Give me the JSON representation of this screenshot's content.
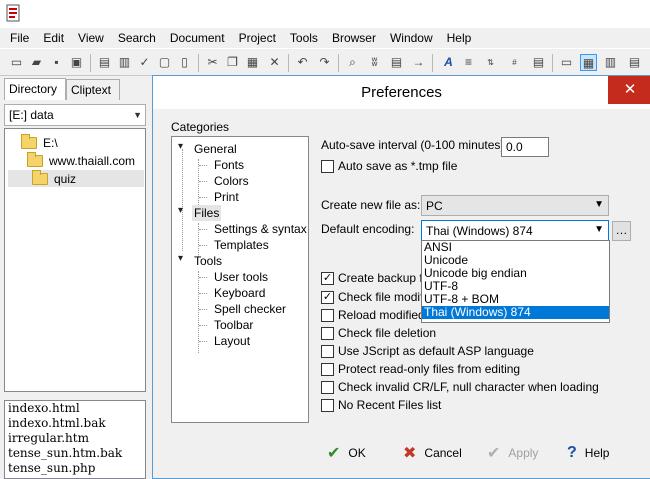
{
  "menu": [
    "File",
    "Edit",
    "View",
    "Search",
    "Document",
    "Project",
    "Tools",
    "Browser",
    "Window",
    "Help"
  ],
  "left": {
    "tabs": [
      "Directory",
      "Cliptext"
    ],
    "drive": "[E:] data",
    "tree": [
      {
        "label": "E:\\",
        "level": 0
      },
      {
        "label": "www.thaiall.com",
        "level": 1
      },
      {
        "label": "quiz",
        "level": 2,
        "selected": true
      }
    ],
    "files": [
      "indexo.html",
      "indexo.html.bak",
      "irregular.htm",
      "tense_sun.htm.bak",
      "tense_sun.php"
    ]
  },
  "dialog": {
    "title": "Preferences",
    "close": "✕",
    "categories_label": "Categories",
    "categories": {
      "general": "General",
      "fonts": "Fonts",
      "colors": "Colors",
      "print": "Print",
      "files": "Files",
      "settings_syntax": "Settings & syntax",
      "templates": "Templates",
      "tools": "Tools",
      "user_tools": "User tools",
      "keyboard": "Keyboard",
      "spell_checker": "Spell checker",
      "toolbar": "Toolbar",
      "layout": "Layout"
    },
    "autosave_label": "Auto-save interval (0-100 minutes):",
    "autosave_value": "0.0",
    "autosave_tmp": "Auto save as *.tmp file",
    "create_new_label": "Create new file as:",
    "create_new_value": "PC",
    "encoding_label": "Default encoding:",
    "encoding_value": "Thai (Windows) 874",
    "encoding_options": [
      "ANSI",
      "Unicode",
      "Unicode big endian",
      "UTF-8",
      "UTF-8 + BOM",
      "Thai (Windows) 874"
    ],
    "checkboxes": {
      "backup": "Create backup file",
      "modific": "Check file modific",
      "reload": "Reload modified f",
      "deletion": "Check file deletion",
      "jscript": "Use JScript as default ASP language",
      "readonly": "Protect read-only files from editing",
      "invalid": "Check invalid CR/LF, null character when loading",
      "recent": "No Recent Files list"
    },
    "buttons": {
      "ok": "OK",
      "cancel": "Cancel",
      "apply": "Apply",
      "help": "Help"
    }
  }
}
